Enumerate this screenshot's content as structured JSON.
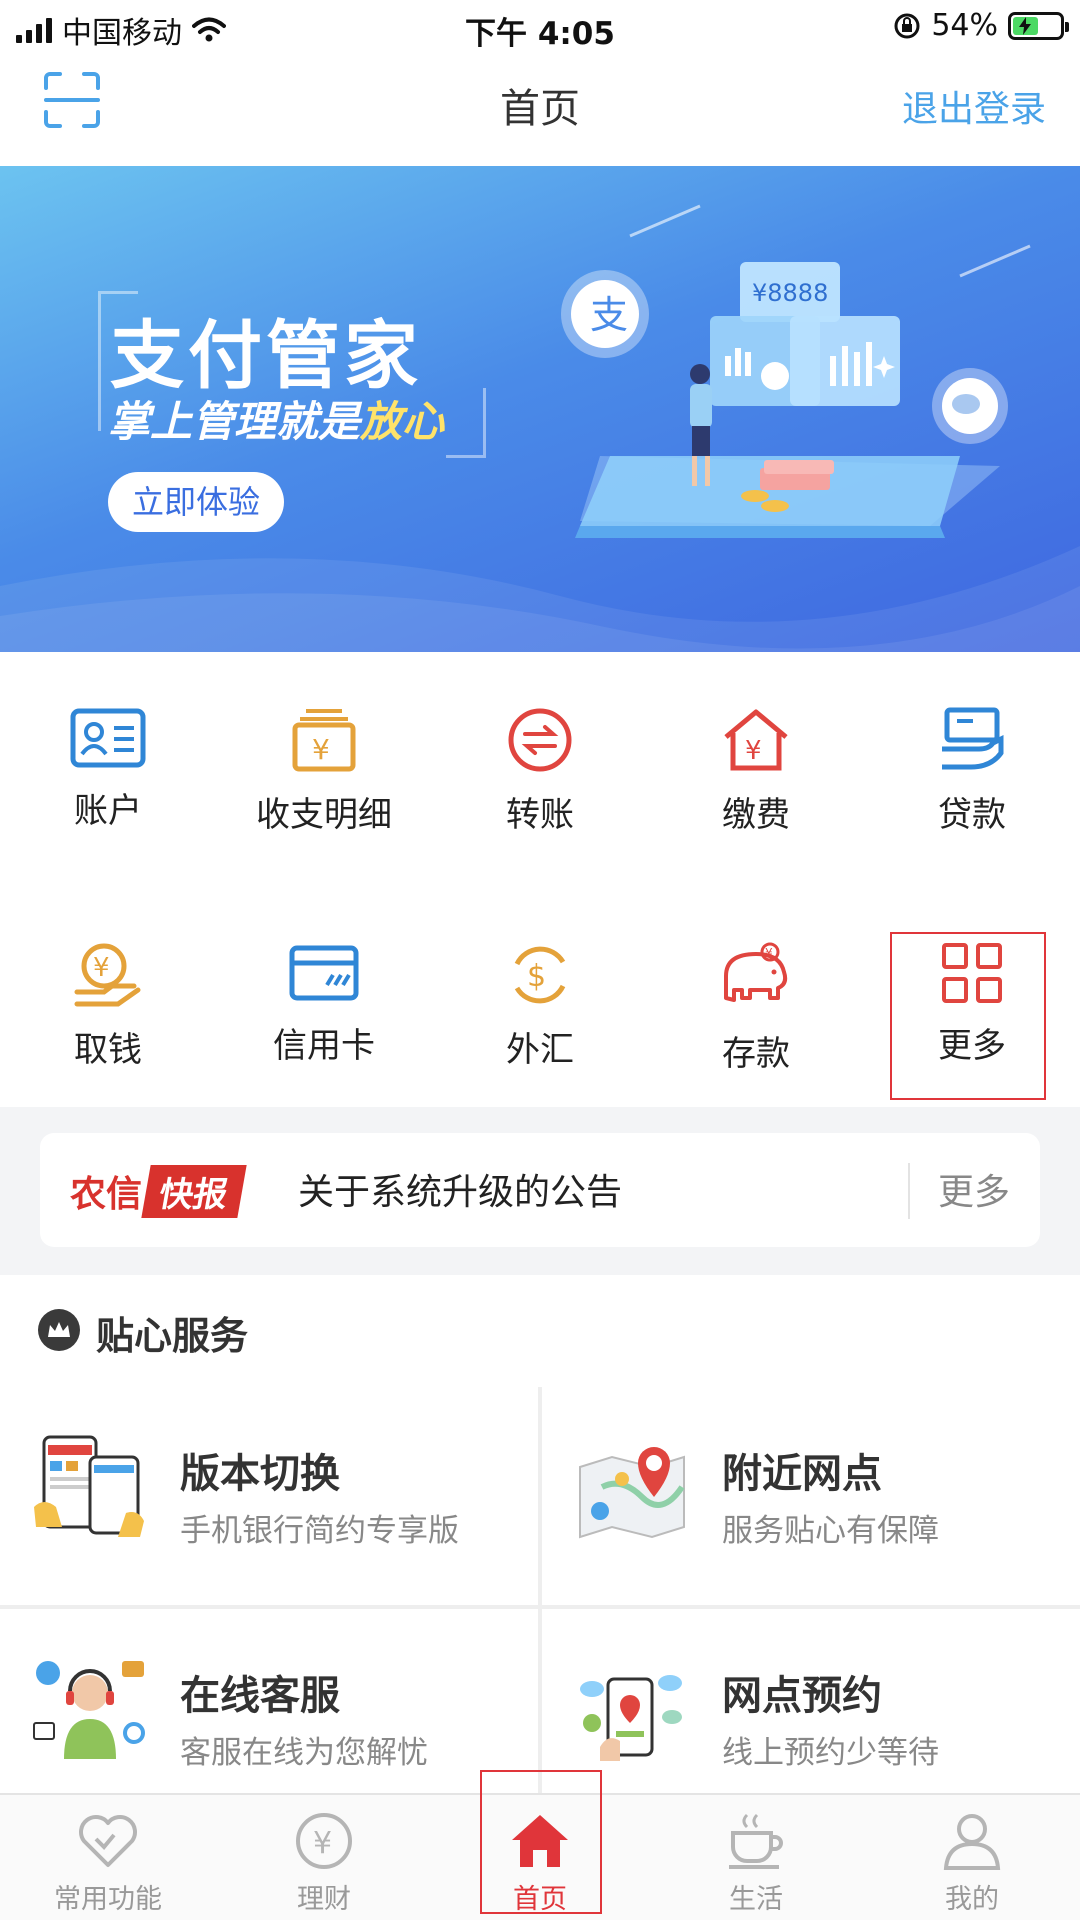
{
  "status_bar": {
    "carrier": "中国移动",
    "time": "下午 4:05",
    "battery": "54%",
    "battery_level": 0.54
  },
  "nav": {
    "title": "首页",
    "logout_label": "退出登录"
  },
  "banner": {
    "title": "支付管家",
    "subtitle_prefix": "掌上管理就是",
    "subtitle_highlight": "放心",
    "button_label": "立即体验",
    "card_amount": "¥8888"
  },
  "grid": {
    "items": [
      {
        "label": "账户",
        "icon": "account-card-icon",
        "color": "#2f86d6"
      },
      {
        "label": "收支明细",
        "icon": "income-expense-icon",
        "color": "#e4a23a"
      },
      {
        "label": "转账",
        "icon": "transfer-icon",
        "color": "#e0453f"
      },
      {
        "label": "缴费",
        "icon": "payment-house-icon",
        "color": "#e0453f"
      },
      {
        "label": "贷款",
        "icon": "loan-icon",
        "color": "#2f86d6"
      },
      {
        "label": "取钱",
        "icon": "withdraw-icon",
        "color": "#e4a23a"
      },
      {
        "label": "信用卡",
        "icon": "credit-card-icon",
        "color": "#2f86d6"
      },
      {
        "label": "外汇",
        "icon": "forex-icon",
        "color": "#e4a23a"
      },
      {
        "label": "存款",
        "icon": "deposit-elephant-icon",
        "color": "#e0453f"
      },
      {
        "label": "更多",
        "icon": "more-grid-icon",
        "color": "#e0453f"
      }
    ]
  },
  "news": {
    "logo_a": "农信",
    "logo_b": "快报",
    "headline": "关于系统升级的公告",
    "more_label": "更多"
  },
  "services": {
    "title": "贴心服务",
    "items": [
      {
        "title": "版本切换",
        "subtitle": "手机银行简约专享版"
      },
      {
        "title": "附近网点",
        "subtitle": "服务贴心有保障"
      },
      {
        "title": "在线客服",
        "subtitle": "客服在线为您解忧"
      },
      {
        "title": "网点预约",
        "subtitle": "线上预约少等待"
      }
    ]
  },
  "tab_bar": {
    "tabs": [
      {
        "label": "常用功能",
        "icon": "heart-icon"
      },
      {
        "label": "理财",
        "icon": "yen-coin-icon"
      },
      {
        "label": "首页",
        "icon": "home-icon"
      },
      {
        "label": "生活",
        "icon": "coffee-cup-icon"
      },
      {
        "label": "我的",
        "icon": "user-icon"
      }
    ],
    "active": "首页"
  },
  "colors": {
    "accent_red": "#e0353a",
    "link_blue": "#4aa3e8"
  }
}
